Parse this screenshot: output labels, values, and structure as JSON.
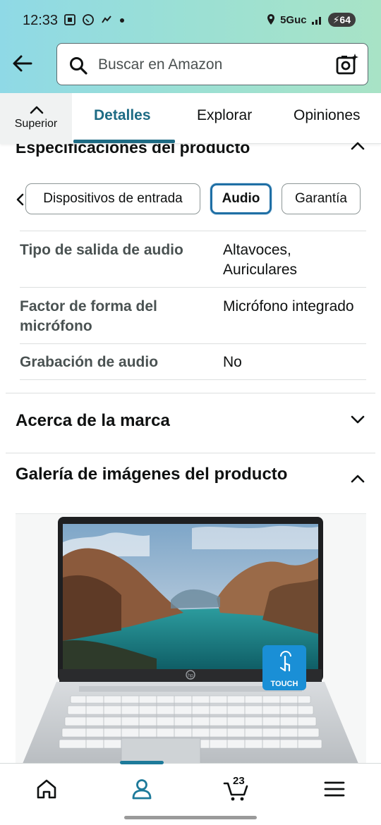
{
  "status_bar": {
    "time": "12:33",
    "network": "5Guc",
    "battery": "64",
    "left_icons": [
      "screenshot-icon",
      "whatsapp-icon",
      "messenger-icon",
      "dot-icon"
    ]
  },
  "header": {
    "search_placeholder": "Buscar en Amazon"
  },
  "tabs": {
    "top_label": "Superior",
    "items": [
      "Detalles",
      "Explorar",
      "Opiniones"
    ],
    "active": "Detalles"
  },
  "specs": {
    "title": "Especificaciones del producto",
    "chips": [
      "Dispositivos de entrada",
      "Audio",
      "Garantía"
    ],
    "selected_chip": "Audio",
    "rows": [
      {
        "key": "Tipo de salida de audio",
        "value": "Altavoces, Auriculares"
      },
      {
        "key": "Factor de forma del micrófono",
        "value": "Micrófono integrado"
      },
      {
        "key": "Grabación de audio",
        "value": "No"
      }
    ]
  },
  "sections": {
    "brand": "Acerca de la marca",
    "gallery": "Galería de imágenes del producto"
  },
  "gallery": {
    "badge_text": "TOUCH",
    "brand_mark": "hp"
  },
  "bottom_nav": {
    "items": [
      "home-icon",
      "account-icon",
      "cart-icon",
      "menu-icon"
    ],
    "cart_count": "23",
    "active": "account-icon"
  },
  "colors": {
    "accent": "#1d6b84",
    "header_gradient_start": "#8fd9e6",
    "header_gradient_end": "#a8e3c6",
    "chip_selected_border": "#1f6fa5"
  }
}
